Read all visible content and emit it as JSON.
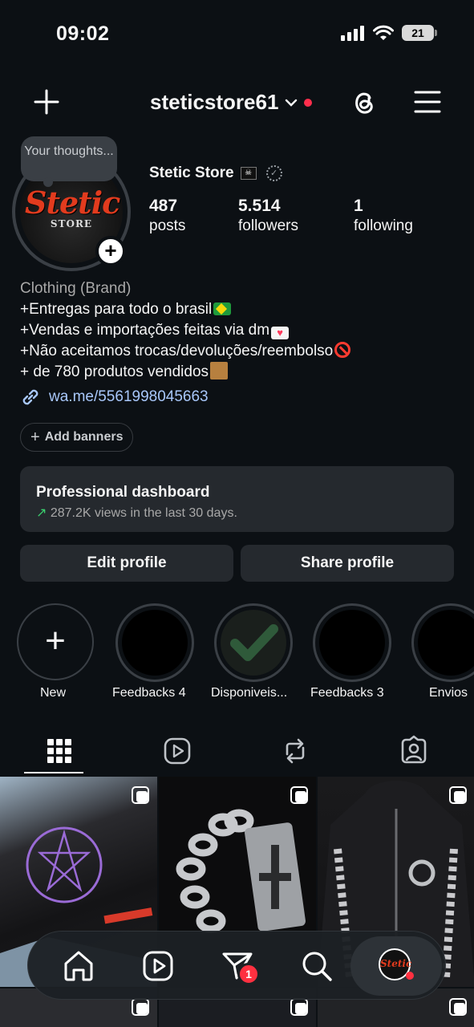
{
  "status": {
    "time": "09:02",
    "battery": "21"
  },
  "header": {
    "username": "steticstore61"
  },
  "avatar": {
    "logo_text": "Stetic",
    "logo_sub": "STORE",
    "thought_bubble": "Your thoughts..."
  },
  "profile": {
    "name": "Stetic Store",
    "stats": [
      {
        "value": "487",
        "label": "posts"
      },
      {
        "value": "5.514",
        "label": "followers"
      },
      {
        "value": "1",
        "label": "following"
      }
    ],
    "category": "Clothing (Brand)",
    "bio_lines": [
      "+Entregas para todo o brasil",
      "+Vendas e importações feitas via dm",
      "+Não aceitamos trocas/devoluções/reembolso",
      "+ de 780 produtos vendidos"
    ],
    "link": "wa.me/5561998045663",
    "add_banners": "Add banners"
  },
  "dashboard": {
    "title": "Professional dashboard",
    "subtitle": "287.2K views in the last 30 days."
  },
  "buttons": {
    "edit": "Edit profile",
    "share": "Share profile"
  },
  "highlights": [
    {
      "label": "New"
    },
    {
      "label": "Feedbacks 4"
    },
    {
      "label": "Disponiveis..."
    },
    {
      "label": "Feedbacks 3"
    },
    {
      "label": "Envios"
    }
  ],
  "bottom_nav": {
    "notification_count": "1",
    "avatar_text": "Stetic"
  },
  "colors": {
    "background": "#0c1014",
    "surface": "#25292e",
    "link": "#a8c7fa",
    "badge": "#ff3040"
  }
}
